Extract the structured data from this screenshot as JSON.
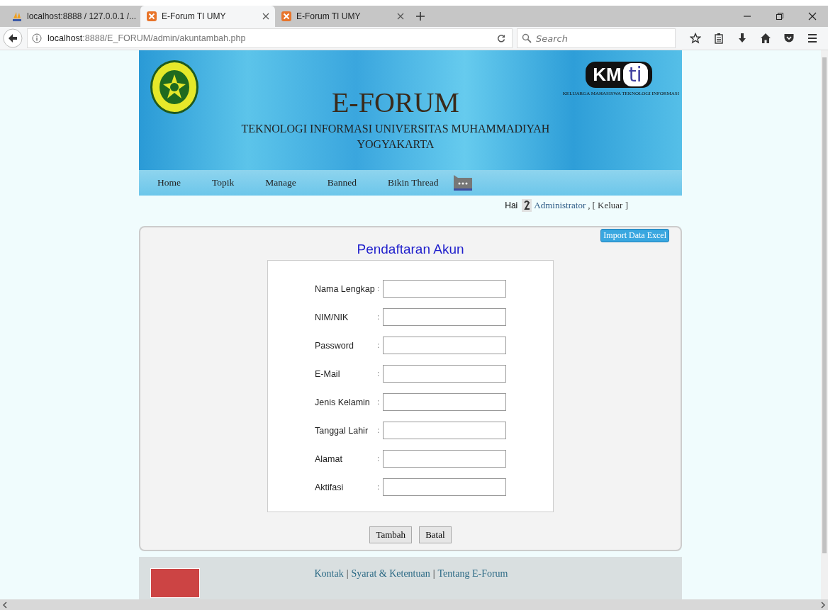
{
  "browser": {
    "tabs": [
      {
        "title": "localhost:8888 / 127.0.0.1 /...",
        "selected": false
      },
      {
        "title": "E-Forum TI UMY",
        "selected": true
      },
      {
        "title": "E-Forum TI UMY",
        "selected": false
      }
    ],
    "url_host": "localhost",
    "url_rest": ":8888/E_FORUM/admin/akuntambah.php",
    "search": {
      "placeholder": "Search"
    }
  },
  "header": {
    "title": "E-FORUM",
    "subtitle": "TEKNOLOGI INFORMASI UNIVERSITAS MUHAMMADIYAH YOGYAKARTA",
    "logo_right": {
      "text_k": "KM",
      "text_ti": "ti",
      "caption": "KELUARGA MAHASISWA TEKNOLOGI INFORMASI"
    }
  },
  "nav": [
    "Home",
    "Topik",
    "Manage",
    "Banned",
    "Bikin Thread"
  ],
  "user_bar": {
    "greeting": "Hai",
    "user": "Administrator",
    "comma": ",",
    "logout": "[ Keluar ]"
  },
  "form": {
    "import_button": "Import Data Excel",
    "title": "Pendaftaran Akun",
    "colon": ":",
    "fields": [
      "Nama Lengkap",
      "NIM/NIK",
      "Password",
      "E-Mail",
      "Jenis Kelamin",
      "Tanggal Lahir",
      "Alamat",
      "Aktifasi"
    ],
    "buttons": [
      "Tambah",
      "Batal"
    ]
  },
  "footer": {
    "links": [
      "Kontak",
      "Syarat & Ketentuan",
      "Tentang E-Forum"
    ],
    "separator": "|"
  }
}
